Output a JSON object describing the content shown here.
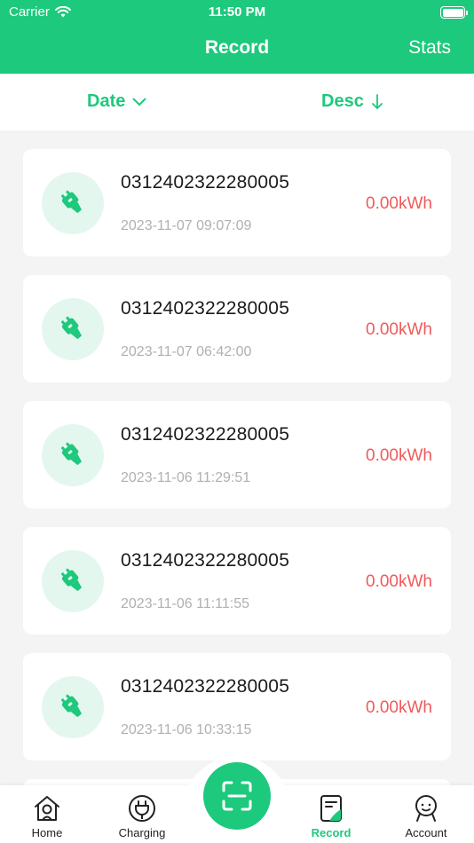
{
  "status_bar": {
    "carrier": "Carrier",
    "time": "11:50 PM"
  },
  "nav": {
    "title": "Record",
    "right_action": "Stats"
  },
  "filters": {
    "date_label": "Date",
    "order_label": "Desc"
  },
  "records": [
    {
      "id": "0312402322280005",
      "datetime": "2023-11-07 09:07:09",
      "energy": "0.00kWh"
    },
    {
      "id": "0312402322280005",
      "datetime": "2023-11-07 06:42:00",
      "energy": "0.00kWh"
    },
    {
      "id": "0312402322280005",
      "datetime": "2023-11-06 11:29:51",
      "energy": "0.00kWh"
    },
    {
      "id": "0312402322280005",
      "datetime": "2023-11-06 11:11:55",
      "energy": "0.00kWh"
    },
    {
      "id": "0312402322280005",
      "datetime": "2023-11-06 10:33:15",
      "energy": "0.00kWh"
    }
  ],
  "tabbar": {
    "home": "Home",
    "charging": "Charging",
    "record": "Record",
    "account": "Account",
    "active": "record"
  },
  "colors": {
    "brand": "#1dc97c",
    "energy": "#f05a5a",
    "muted": "#b0b0b0"
  },
  "icons": {
    "record_item": "charging-plug-icon",
    "home": "home-icon",
    "charging": "plug-icon",
    "scan": "scan-icon",
    "record": "record-icon",
    "account": "account-icon"
  }
}
